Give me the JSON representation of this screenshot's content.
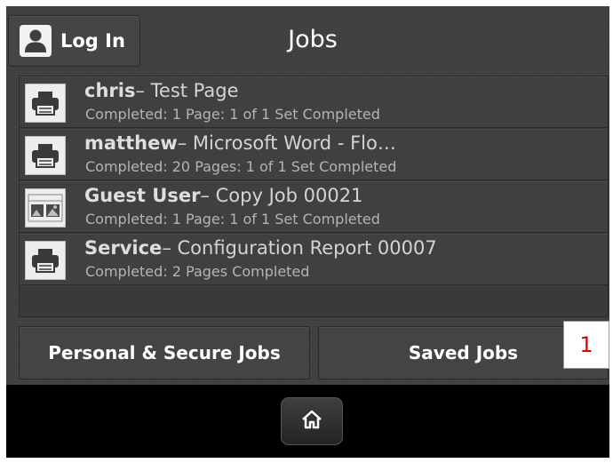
{
  "header": {
    "login_label": "Log In",
    "title": "Jobs"
  },
  "jobs": [
    {
      "owner": "chris",
      "separator": "– ",
      "name": "Test Page",
      "status": "Completed: 1 Page: 1 of 1 Set Completed",
      "icon": "printer-icon"
    },
    {
      "owner": "matthew",
      "separator": "– ",
      "name": "Microsoft Word - Flo…",
      "status": "Completed: 20 Pages: 1 of 1 Set Completed",
      "icon": "printer-icon"
    },
    {
      "owner": "Guest User",
      "separator": "– ",
      "name": "Copy Job 00021",
      "status": "Completed: 1 Page: 1 of 1 Set Completed",
      "icon": "copy-job-icon"
    },
    {
      "owner": "Service",
      "separator": "– ",
      "name": "Configuration Report 00007",
      "status": "Completed: 2 Pages Completed",
      "icon": "printer-icon"
    }
  ],
  "buttons": {
    "personal_secure": "Personal & Secure Jobs",
    "saved": "Saved Jobs"
  },
  "annotation": {
    "number": "1",
    "color": "#e00000"
  },
  "footer": {
    "home_icon": "home-icon"
  }
}
